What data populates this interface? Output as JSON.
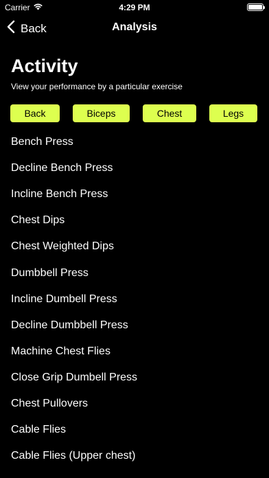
{
  "status_bar": {
    "carrier": "Carrier",
    "time": "4:29 PM"
  },
  "nav": {
    "back_label": "Back",
    "title": "Analysis"
  },
  "header": {
    "title": "Activity",
    "subtitle": "View your performance by a particular exercise"
  },
  "filters": {
    "items": [
      "Back",
      "Biceps",
      "Chest",
      "Legs"
    ],
    "color": "#ddff4f"
  },
  "exercises": [
    "Bench Press",
    "Decline Bench Press",
    "Incline Bench Press",
    "Chest Dips",
    "Chest Weighted Dips",
    "Dumbbell Press",
    "Incline Dumbell Press",
    "Decline Dumbbell Press",
    "Machine Chest Flies",
    "Close Grip Dumbell Press",
    "Chest Pullovers",
    "Cable Flies",
    "Cable Flies (Upper chest)"
  ],
  "icons": [
    "wifi-icon",
    "battery-icon",
    "chevron-left-icon"
  ]
}
